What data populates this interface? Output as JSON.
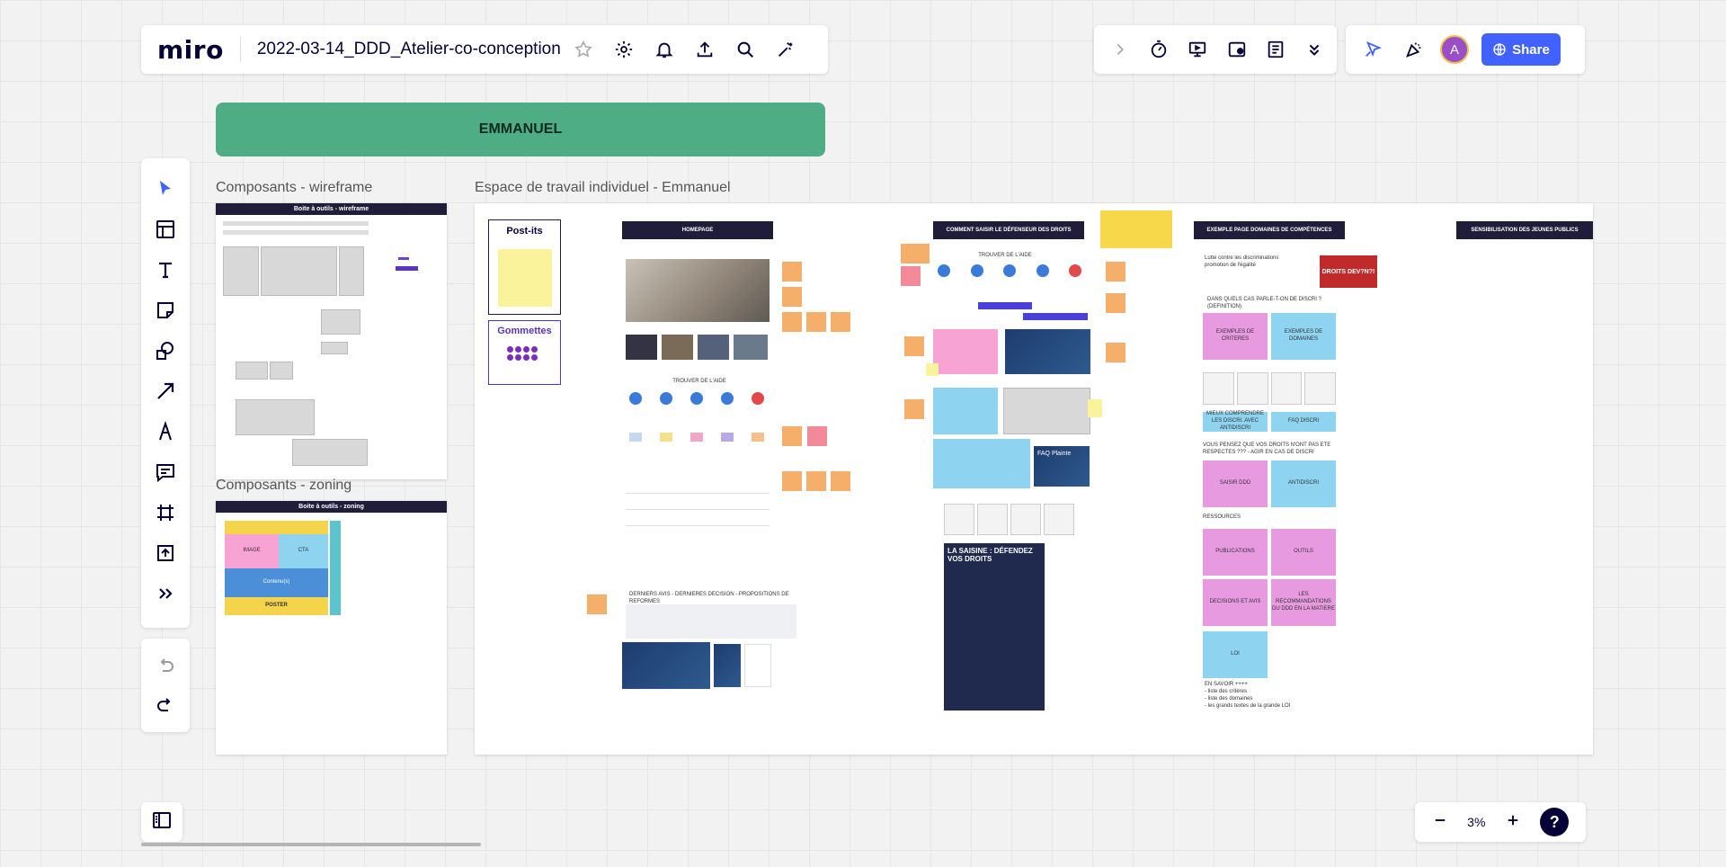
{
  "app": {
    "logo": "miro",
    "board_title": "2022-03-14_DDD_Atelier-co-conception",
    "icons": [
      "star-icon",
      "gear-icon",
      "bell-icon",
      "upload-icon",
      "search-icon",
      "magic-icon"
    ],
    "right_icons": [
      "chevron-right-icon",
      "timer-icon",
      "presentation-icon",
      "card-icon",
      "notes-icon",
      "more-down-icon"
    ],
    "avatar_initial": "A",
    "share_label": "Share",
    "zoom_level": "3%",
    "help_label": "?",
    "accent_color": "#4262ff"
  },
  "toolbar": {
    "tools": [
      "cursor-icon",
      "template-icon",
      "text-icon",
      "sticky-note-icon",
      "shapes-icon",
      "arrow-icon",
      "pen-icon",
      "comment-icon",
      "frame-icon",
      "upload-icon",
      "more-tools-icon"
    ]
  },
  "board": {
    "header_band": "EMMANUEL",
    "header_color": "#4fad86",
    "frames": {
      "wireframe_label": "Composants - wireframe",
      "wireframe_head": "Boite à outils - wireframe",
      "zoning_label": "Composants - zoning",
      "zoning_head": "Boite à outils - zoning",
      "zoning_blocks": [
        "IMAGE",
        "CTA",
        "Contenu(s)",
        "POSTER"
      ],
      "workspace_label": "Espace de travail individuel - Emmanuel"
    },
    "workspace": {
      "postits_title": "Post-its",
      "gommettes_title": "Gommettes",
      "col_heads": [
        "HOMEPAGE",
        "COMMENT SAISIR LE DÉFENSEUR DES DROITS",
        "EXEMPLE PAGE DOMAINES DE COMPÉTENCES",
        "SENSIBILISATION DES JEUNES PUBLICS"
      ],
      "home_subhead": "TROUVER DE L'AIDE",
      "saisir_subhead": "TROUVER DE L'AIDE",
      "faq_label": "FAQ Plainte",
      "saisine_title": "LA SAISINE : DÉFENDEZ VOS DROITS",
      "domaines_title": "Lutte contre les discriminations promotion de l'égalité",
      "domaines_question": "DANS QUELS CAS PARLE-T-ON DE DISCRI ? (DEFINITION)",
      "domaines_boxes": [
        "EXEMPLES DE CRITERES",
        "EXEMPLES DE DOMAINES",
        "MIEUX COMPRENDRE LES DISCRI. AVEC ANTIDISCRI",
        "FAQ DISCRI",
        "SAISIR DDD",
        "ANTIDISCRI",
        "PUBLICATIONS",
        "OUTILS",
        "DECISIONS ET AVIS",
        "LES RECOMMANDATIONS DU DDD EN LA MATIERE",
        "LOI"
      ],
      "domaines_question2": "VOUS PENSEZ QUE VOS DROITS N'ONT PAS ETE RESPECTES ??? - AGIR EN CAS DE DISCRI",
      "ressources": "RESSOURCES",
      "en_savoir": "EN SAVOIR ++++",
      "en_savoir_items": [
        "- liste des critères",
        "- liste des domaines",
        "- les grands textes de la grande LOI"
      ],
      "derniers": "DERNIERS AVIS - DERNIERES DECISION - PROPOSITIONS DE REFORMES",
      "droits_label": "DROITS DEV?N?!"
    }
  }
}
